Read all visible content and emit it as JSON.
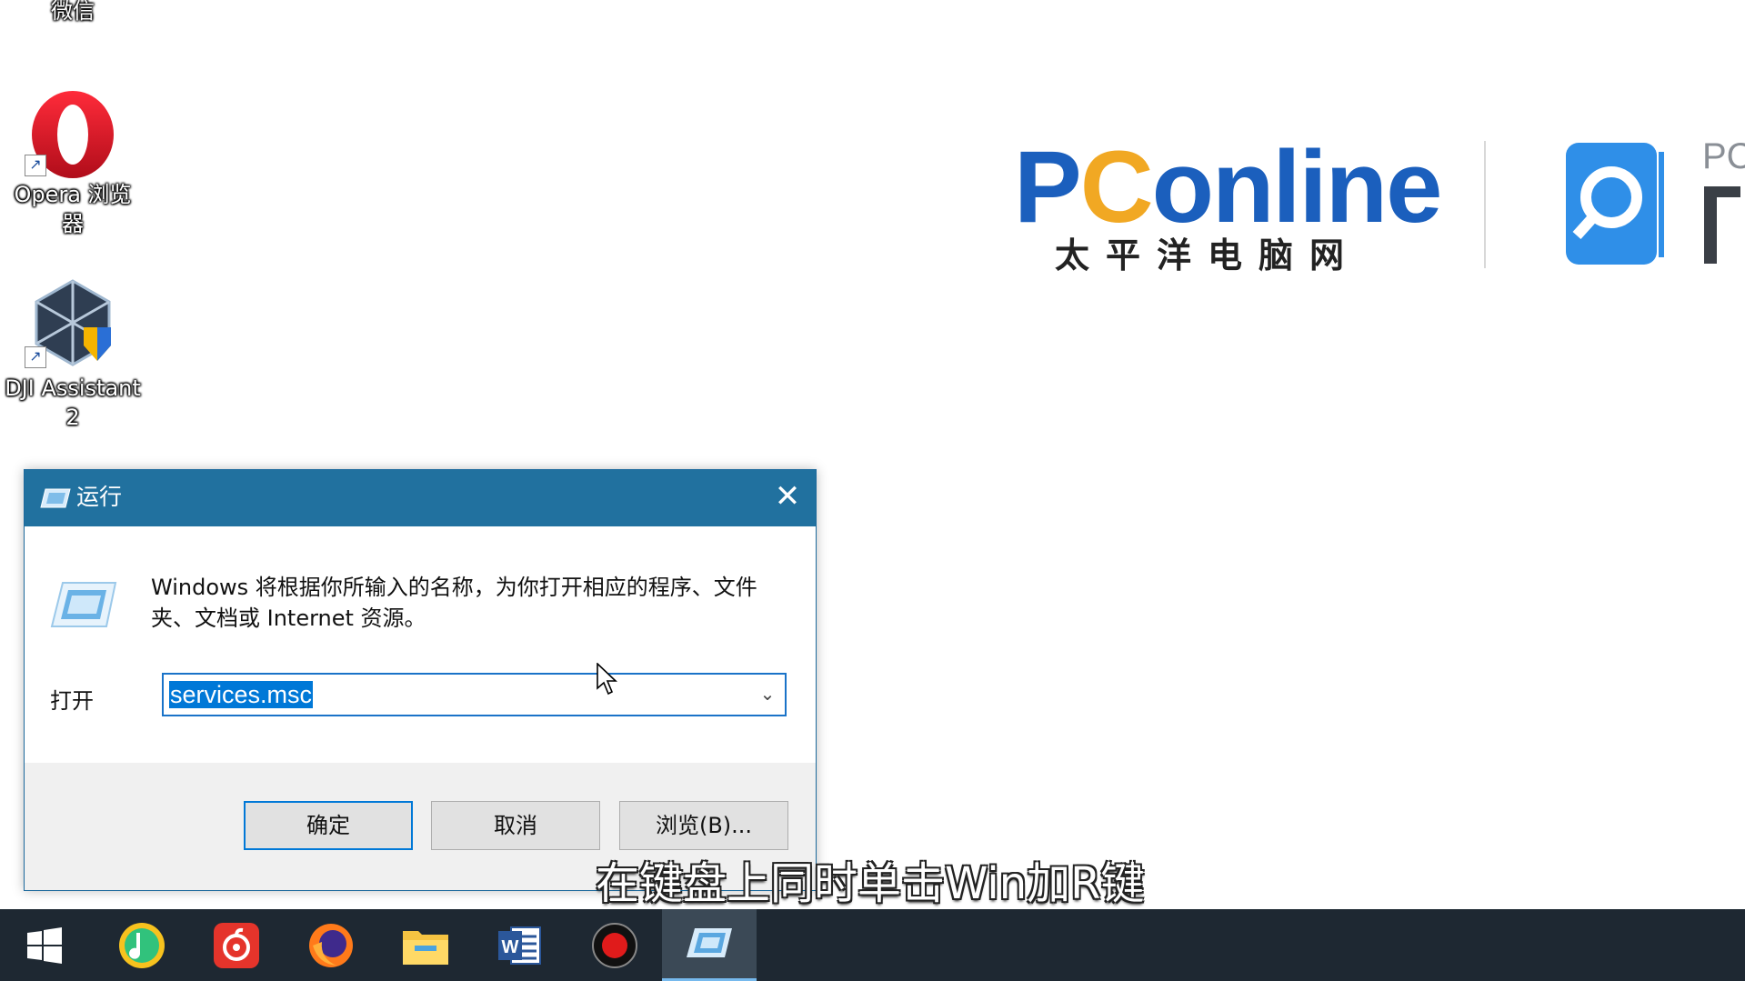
{
  "desktop": {
    "icons": [
      {
        "label": "微信"
      },
      {
        "label_line1": "Opera 浏览",
        "label_line2": "器"
      },
      {
        "label_line1": "DJI Assistant",
        "label_line2": "2"
      }
    ]
  },
  "logo": {
    "brand_prefix": "P",
    "brand_ring": "C",
    "brand_suffix": "online",
    "brand_sub": "太平洋电脑网",
    "secondary_text": "PC",
    "colors": {
      "blue": "#1b5fbd",
      "orange": "#f1a823"
    }
  },
  "run_dialog": {
    "title": "运行",
    "description": "Windows 将根据你所输入的名称，为你打开相应的程序、文件夹、文档或 Internet 资源。",
    "open_label": "打开",
    "open_value": "services.msc",
    "buttons": {
      "ok": "确定",
      "cancel": "取消",
      "browse": "浏览(B)..."
    },
    "title_bar_color": "#21719f"
  },
  "subtitle": "在键盘上同时单击Win加R键",
  "taskbar": {
    "items": [
      "start-icon",
      "qq-music-icon",
      "netease-music-icon",
      "firefox-icon",
      "file-explorer-icon",
      "word-icon",
      "record-icon",
      "run-icon"
    ],
    "active": "run-icon"
  }
}
